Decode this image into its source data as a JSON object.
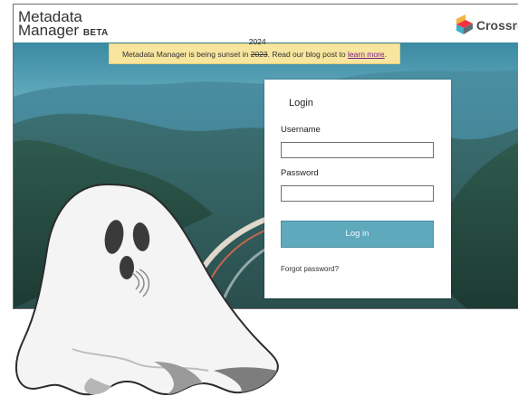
{
  "header": {
    "app_name_line1": "Metadata",
    "app_name_line2": "Manager",
    "beta_badge": "BETA",
    "crossref_logo_text": "Crossref"
  },
  "banner": {
    "text_before": "Metadata Manager is being sunset in ",
    "struck_year": "2023",
    "replacement_year": "2024",
    "text_middle": ". Read our blog post to ",
    "link_text": "learn more",
    "text_after": "."
  },
  "login": {
    "title": "Login",
    "username_label": "Username",
    "username_value": "",
    "password_label": "Password",
    "password_value": "",
    "submit_label": "Log in",
    "forgot_link": "Forgot password?"
  },
  "colors": {
    "banner_bg": "#f8e59e",
    "button_bg": "#5fa9bd",
    "link": "#7a1d8a"
  },
  "icons": {
    "brand_logo": "crossref-logo-icon",
    "overlay": "ghost-illustration"
  }
}
